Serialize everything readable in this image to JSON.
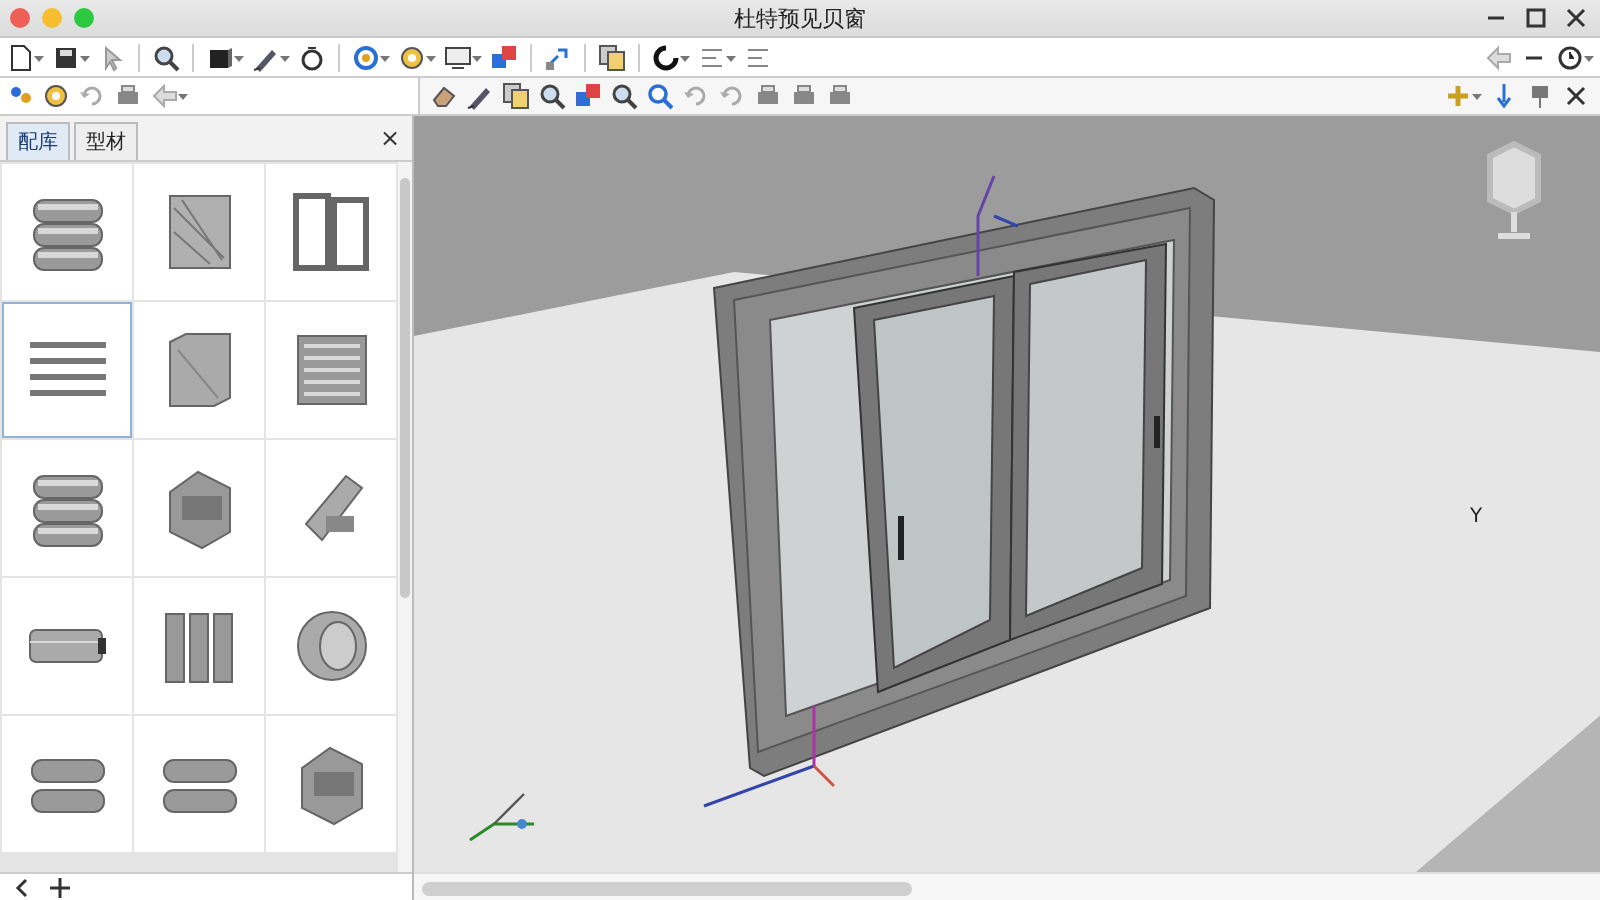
{
  "window": {
    "title": "杜特预见贝窗"
  },
  "library_panel": {
    "tabs": [
      {
        "label": "配库",
        "selected": true
      },
      {
        "label": "型材",
        "selected": false
      }
    ],
    "close": "×",
    "items": [
      {
        "kind": "rods",
        "selected": false
      },
      {
        "kind": "texture",
        "selected": false
      },
      {
        "kind": "frames",
        "selected": false
      },
      {
        "kind": "strips",
        "selected": true
      },
      {
        "kind": "block",
        "selected": false
      },
      {
        "kind": "louver",
        "selected": false
      },
      {
        "kind": "rods",
        "selected": false
      },
      {
        "kind": "bracket",
        "selected": false
      },
      {
        "kind": "profile",
        "selected": false
      },
      {
        "kind": "cylinder",
        "selected": false
      },
      {
        "kind": "plates",
        "selected": false
      },
      {
        "kind": "wheel",
        "selected": false
      },
      {
        "kind": "pair",
        "selected": false
      },
      {
        "kind": "pair",
        "selected": false
      },
      {
        "kind": "bracket",
        "selected": false
      }
    ]
  },
  "viewport": {
    "axis_label": "Y"
  }
}
